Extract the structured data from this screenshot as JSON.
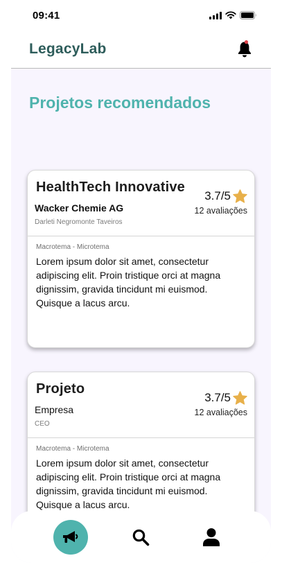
{
  "status_bar": {
    "time": "09:41"
  },
  "header": {
    "title": "LegacyLab"
  },
  "section": {
    "title": "Projetos recomendados"
  },
  "cards": [
    {
      "title": "HealthTech Innovative",
      "company": "Wacker Chemie AG",
      "person": "Darleti Negromonte Taveiros",
      "rating": "3.7/5",
      "reviews": "12 avaliações",
      "tags": "Macrotema - Microtema",
      "description": "Lorem ipsum dolor sit amet, consectetur adipiscing elit. Proin tristique orci at magna dignissim, gravida tincidunt mi euismod. Quisque a lacus arcu."
    },
    {
      "title": "Projeto",
      "company": "Empresa",
      "person": "CEO",
      "rating": "3.7/5",
      "reviews": "12 avaliações",
      "tags": "Macrotema - Microtema",
      "description": "Lorem ipsum dolor sit amet, consectetur adipiscing elit. Proin tristique orci at magna dignissim, gravida tincidunt mi euismod. Quisque a lacus arcu."
    }
  ],
  "nav": {
    "items": [
      {
        "icon": "megaphone-icon",
        "active": true
      },
      {
        "icon": "search-icon",
        "active": false
      },
      {
        "icon": "user-icon",
        "active": false
      }
    ]
  },
  "colors": {
    "accent": "#4fb3ad",
    "brand": "#2e5d5b",
    "background": "#f8f5fe",
    "star": "#e8b04a",
    "notification_dot": "#e0434b"
  }
}
